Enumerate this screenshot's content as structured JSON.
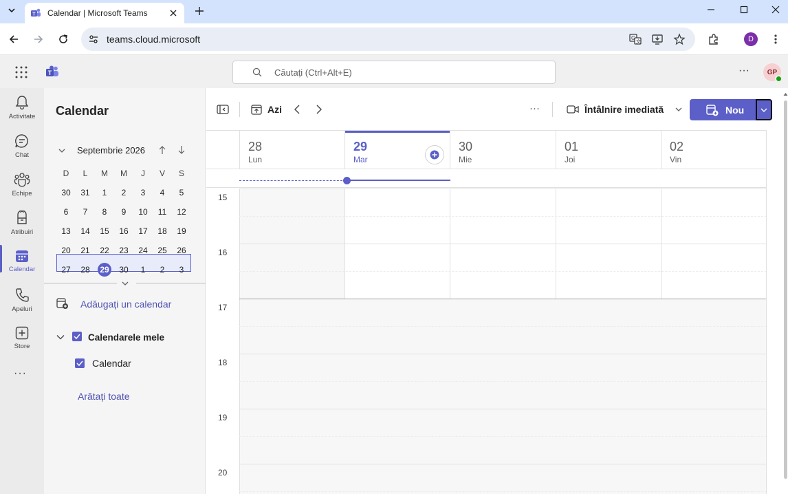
{
  "browser": {
    "tab_title": "Calendar | Microsoft Teams",
    "url": "teams.cloud.microsoft",
    "profile_initial": "D"
  },
  "teams": {
    "search_placeholder": "Căutați (Ctrl+Alt+E)",
    "avatar_initials": "GP"
  },
  "rail": {
    "items": [
      {
        "label": "Activitate",
        "icon": "bell-icon"
      },
      {
        "label": "Chat",
        "icon": "chat-icon"
      },
      {
        "label": "Echipe",
        "icon": "teams-icon"
      },
      {
        "label": "Atribuiri",
        "icon": "assignments-icon"
      },
      {
        "label": "Calendar",
        "icon": "calendar-icon"
      },
      {
        "label": "Apeluri",
        "icon": "phone-icon"
      },
      {
        "label": "Store",
        "icon": "store-icon"
      }
    ],
    "more": "···"
  },
  "sidebar": {
    "title": "Calendar",
    "month_label": "Septembrie 2026",
    "weekdays": [
      "D",
      "L",
      "M",
      "M",
      "J",
      "V",
      "S"
    ],
    "weeks": [
      [
        "30",
        "31",
        "1",
        "2",
        "3",
        "4",
        "5"
      ],
      [
        "6",
        "7",
        "8",
        "9",
        "10",
        "11",
        "12"
      ],
      [
        "13",
        "14",
        "15",
        "16",
        "17",
        "18",
        "19"
      ],
      [
        "20",
        "21",
        "22",
        "23",
        "24",
        "25",
        "26"
      ],
      [
        "27",
        "28",
        "29",
        "30",
        "1",
        "2",
        "3"
      ]
    ],
    "today": "29",
    "add_calendar": "Adăugați un calendar",
    "group_label": "Calendarele mele",
    "calendar_item": "Calendar",
    "show_all": "Arătați toate"
  },
  "commandbar": {
    "today_label": "Azi",
    "more": "···",
    "meet_now": "Întâlnire imediată",
    "new_label": "Nou"
  },
  "days": [
    {
      "num": "28",
      "name": "Lun"
    },
    {
      "num": "29",
      "name": "Mar"
    },
    {
      "num": "30",
      "name": "Mie"
    },
    {
      "num": "01",
      "name": "Joi"
    },
    {
      "num": "02",
      "name": "Vin"
    }
  ],
  "hours": [
    "15",
    "16",
    "17",
    "18",
    "19",
    "20"
  ],
  "colors": {
    "accent": "#5b5fc7",
    "rail_bg": "#ebebeb",
    "pane_bg": "#f5f5f5"
  }
}
